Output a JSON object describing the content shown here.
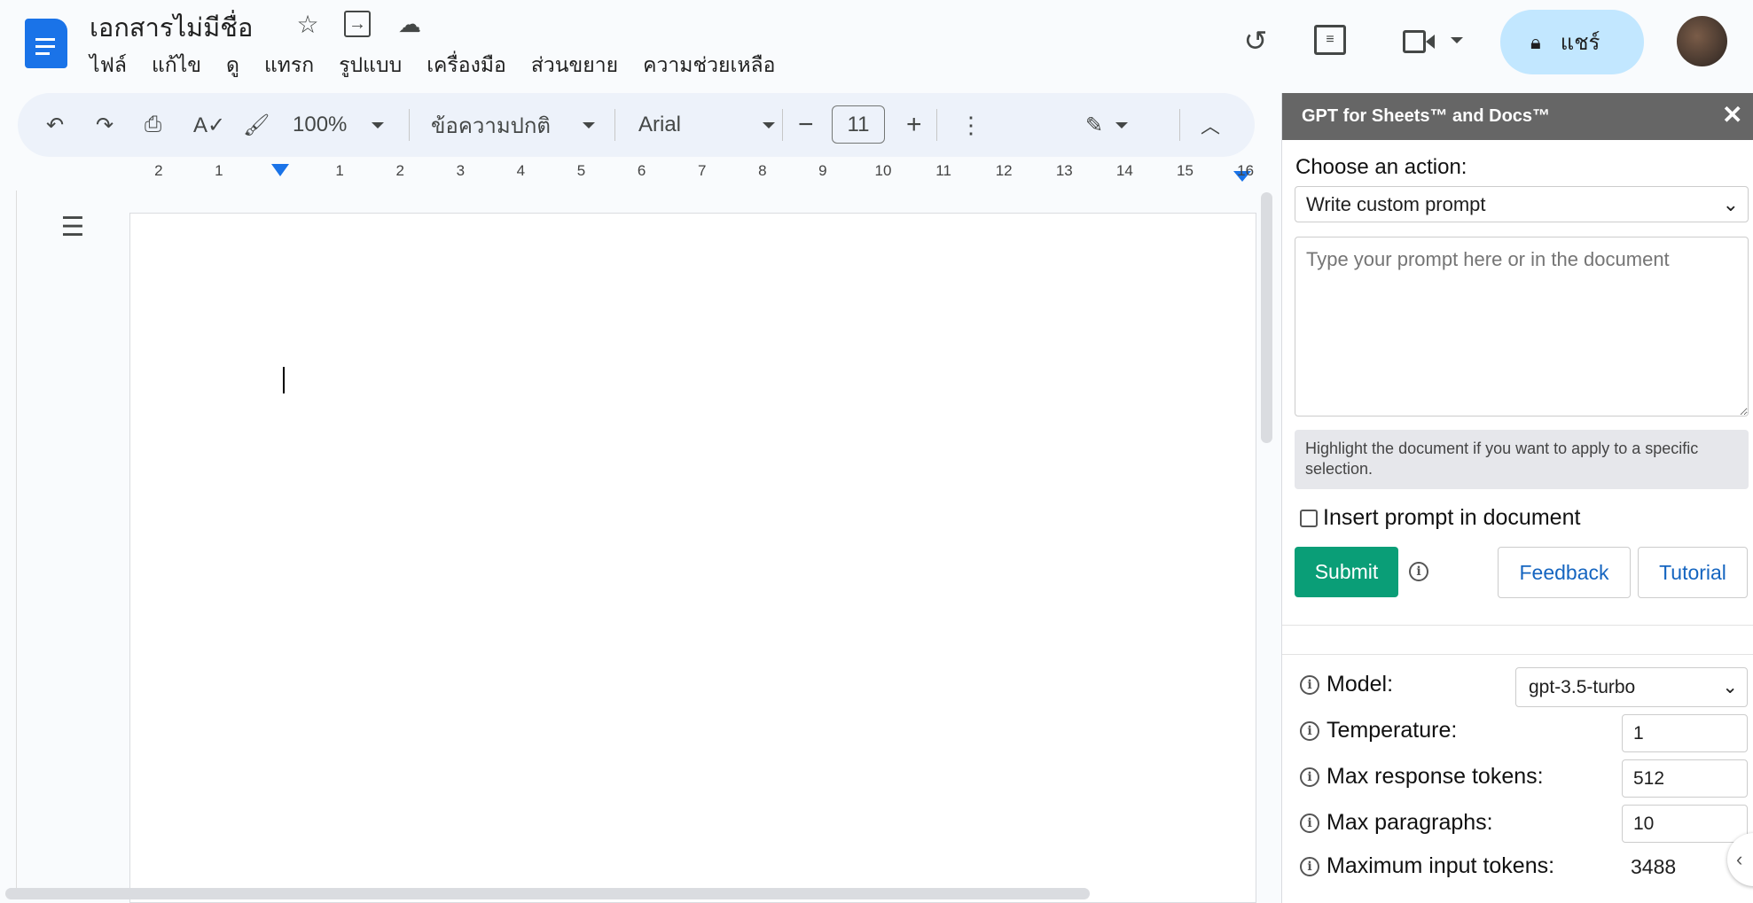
{
  "doc": {
    "title": "เอกสารไม่มีชื่อ",
    "menu": [
      "ไฟล์",
      "แก้ไข",
      "ดู",
      "แทรก",
      "รูปแบบ",
      "เครื่องมือ",
      "ส่วนขยาย",
      "ความช่วยเหลือ"
    ],
    "share_label": "แชร์"
  },
  "toolbar": {
    "zoom": "100%",
    "style": "ข้อความปกติ",
    "font": "Arial",
    "font_size": "11"
  },
  "ruler": {
    "numbers": [
      -2,
      -1,
      1,
      2,
      3,
      4,
      5,
      6,
      7,
      8,
      9,
      10,
      11,
      12,
      13,
      14,
      15,
      16
    ]
  },
  "panel": {
    "title": "GPT for Sheets™ and Docs™",
    "choose_label": "Choose an action:",
    "action": "Write custom prompt",
    "prompt_placeholder": "Type your prompt here or in the document",
    "note": "Highlight the document if you want to apply to a specific selection.",
    "insert_label": "Insert prompt in document",
    "submit": "Submit",
    "feedback": "Feedback",
    "tutorial": "Tutorial",
    "model_label": "Model:",
    "model": "gpt-3.5-turbo",
    "temperature_label": "Temperature:",
    "temperature": "1",
    "max_response_label": "Max response tokens:",
    "max_response": "512",
    "max_paragraphs_label": "Max paragraphs:",
    "max_paragraphs": "10",
    "max_input_label": "Maximum input tokens:",
    "max_input": "3488"
  },
  "colors": {
    "accent": "#0b57d0",
    "submit": "#0a9e77",
    "panel_header": "#666666",
    "share_bg": "#c2e7ff"
  }
}
